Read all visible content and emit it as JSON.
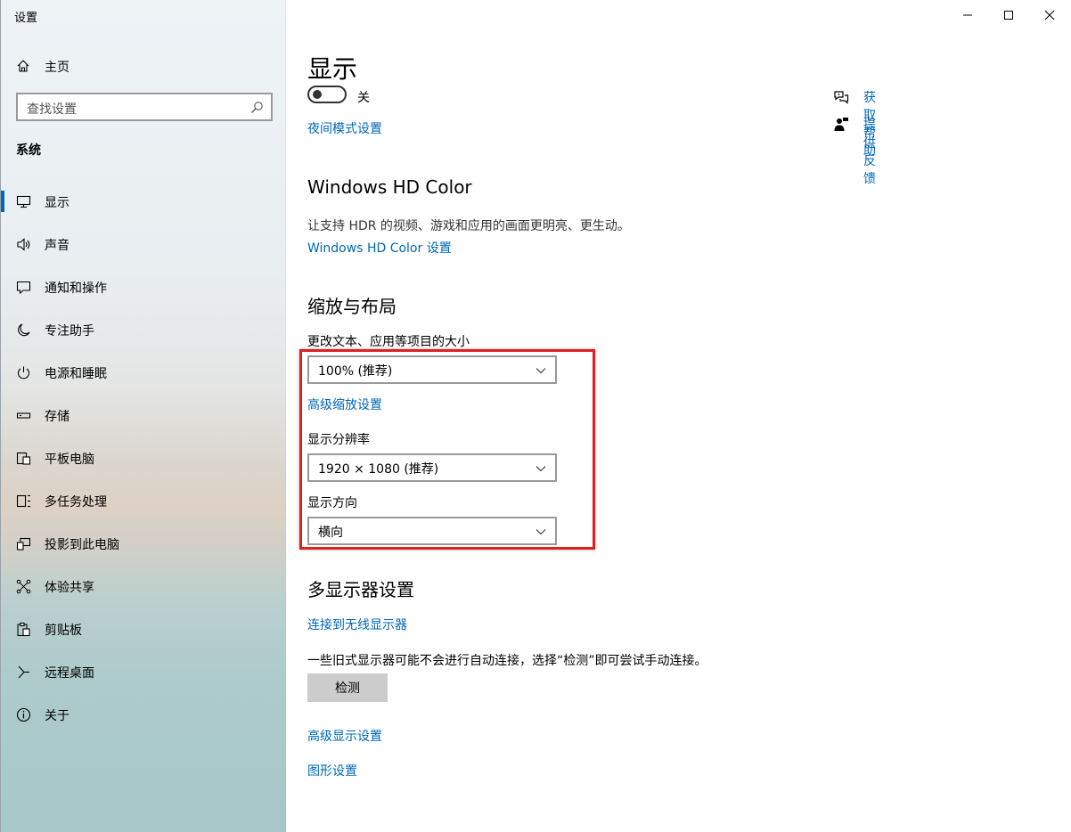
{
  "window": {
    "title": "设置"
  },
  "sidebar": {
    "home_label": "主页",
    "search_placeholder": "查找设置",
    "section_header": "系统",
    "items": [
      {
        "label": "显示",
        "icon": "monitor-icon",
        "active": true
      },
      {
        "label": "声音",
        "icon": "speaker-icon"
      },
      {
        "label": "通知和操作",
        "icon": "notification-icon"
      },
      {
        "label": "专注助手",
        "icon": "moon-icon"
      },
      {
        "label": "电源和睡眠",
        "icon": "power-icon"
      },
      {
        "label": "存储",
        "icon": "storage-icon"
      },
      {
        "label": "平板电脑",
        "icon": "tablet-icon"
      },
      {
        "label": "多任务处理",
        "icon": "multitask-icon"
      },
      {
        "label": "投影到此电脑",
        "icon": "project-icon"
      },
      {
        "label": "体验共享",
        "icon": "share-icon"
      },
      {
        "label": "剪贴板",
        "icon": "clipboard-icon"
      },
      {
        "label": "远程桌面",
        "icon": "remote-desktop-icon"
      },
      {
        "label": "关于",
        "icon": "info-icon"
      }
    ]
  },
  "main": {
    "title": "显示",
    "night_light": {
      "state_label": "关",
      "settings_link": "夜间模式设置"
    },
    "hdr": {
      "heading": "Windows HD Color",
      "description": "让支持 HDR 的视频、游戏和应用的画面更明亮、更生动。",
      "link": "Windows HD Color 设置"
    },
    "scale_layout": {
      "heading": "缩放与布局",
      "scale_label": "更改文本、应用等项目的大小",
      "scale_value": "100% (推荐)",
      "advanced_scaling_link": "高级缩放设置",
      "resolution_label": "显示分辨率",
      "resolution_value": "1920 × 1080 (推荐)",
      "orientation_label": "显示方向",
      "orientation_value": "横向"
    },
    "multi_display": {
      "heading": "多显示器设置",
      "wireless_link": "连接到无线显示器",
      "description": "一些旧式显示器可能不会进行自动连接，选择“检测”即可尝试手动连接。",
      "detect_button": "检测",
      "advanced_display_link": "高级显示设置",
      "graphics_link": "图形设置"
    }
  },
  "help": {
    "get_help": "获取帮助",
    "give_feedback": "提供反馈"
  },
  "colors": {
    "link": "#0067b8",
    "accent": "#0067c0",
    "highlight_box": "#e02020"
  }
}
